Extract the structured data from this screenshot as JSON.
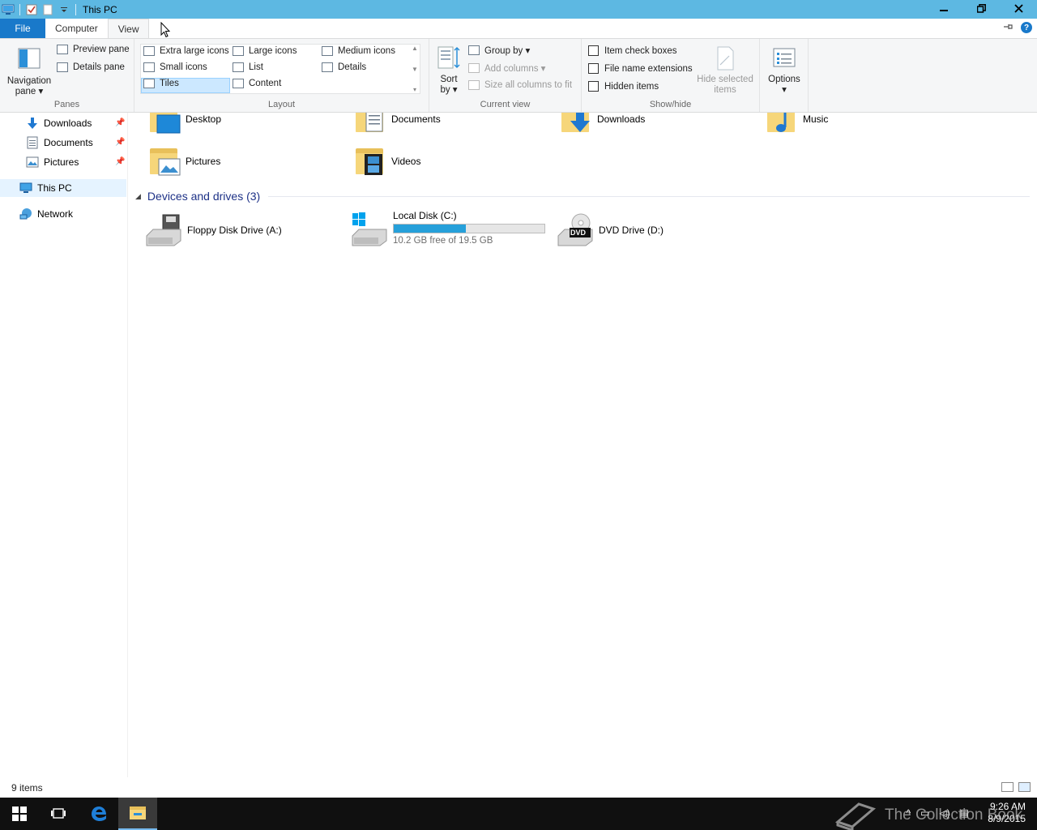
{
  "window": {
    "title": "This PC",
    "minimize": "–",
    "restore": "❐",
    "close": "✕"
  },
  "tabs": {
    "file": "File",
    "computer": "Computer",
    "view": "View"
  },
  "ribbon": {
    "panes": {
      "label": "Panes",
      "navigation_pane_line1": "Navigation",
      "navigation_pane_line2": "pane ▾",
      "preview_pane": "Preview pane",
      "details_pane": "Details pane"
    },
    "layout": {
      "label": "Layout",
      "extra_large_icons": "Extra large icons",
      "large_icons": "Large icons",
      "medium_icons": "Medium icons",
      "small_icons": "Small icons",
      "list": "List",
      "details": "Details",
      "tiles": "Tiles",
      "content": "Content"
    },
    "current_view": {
      "label": "Current view",
      "sort_by_line1": "Sort",
      "sort_by_line2": "by ▾",
      "group_by": "Group by ▾",
      "add_columns": "Add columns ▾",
      "size_all_columns": "Size all columns to fit"
    },
    "show_hide": {
      "label": "Show/hide",
      "item_check_boxes": "Item check boxes",
      "file_name_extensions": "File name extensions",
      "hidden_items": "Hidden items",
      "hide_selected_line1": "Hide selected",
      "hide_selected_line2": "items"
    },
    "options": {
      "label_line1": "Options",
      "label_line2": "▾"
    }
  },
  "nav": {
    "items": [
      {
        "label": "Downloads",
        "pinned": true
      },
      {
        "label": "Documents",
        "pinned": true
      },
      {
        "label": "Pictures",
        "pinned": true
      },
      {
        "label": "This PC",
        "pinned": false
      },
      {
        "label": "Network",
        "pinned": false
      }
    ]
  },
  "content": {
    "folders": [
      {
        "label": "Desktop"
      },
      {
        "label": "Documents"
      },
      {
        "label": "Downloads"
      },
      {
        "label": "Music"
      },
      {
        "label": "Pictures"
      },
      {
        "label": "Videos"
      }
    ],
    "devices_header": "Devices and drives (3)",
    "drives": [
      {
        "label": "Floppy Disk Drive (A:)"
      },
      {
        "label": "Local Disk (C:)",
        "free_text": "10.2 GB free of 19.5 GB",
        "used_fraction": 0.477
      },
      {
        "label": "DVD Drive (D:)",
        "badge": "DVD"
      }
    ]
  },
  "status": {
    "items": "9 items"
  },
  "taskbar": {
    "time": "9:26 AM",
    "date": "8/9/2015"
  },
  "watermark": "The Collection Book",
  "colors": {
    "titlebar": "#5db8e2",
    "file_tab": "#1979ca",
    "section_header": "#1e3287",
    "drive_fill": "#26a0da",
    "selection": "#cce8ff"
  }
}
